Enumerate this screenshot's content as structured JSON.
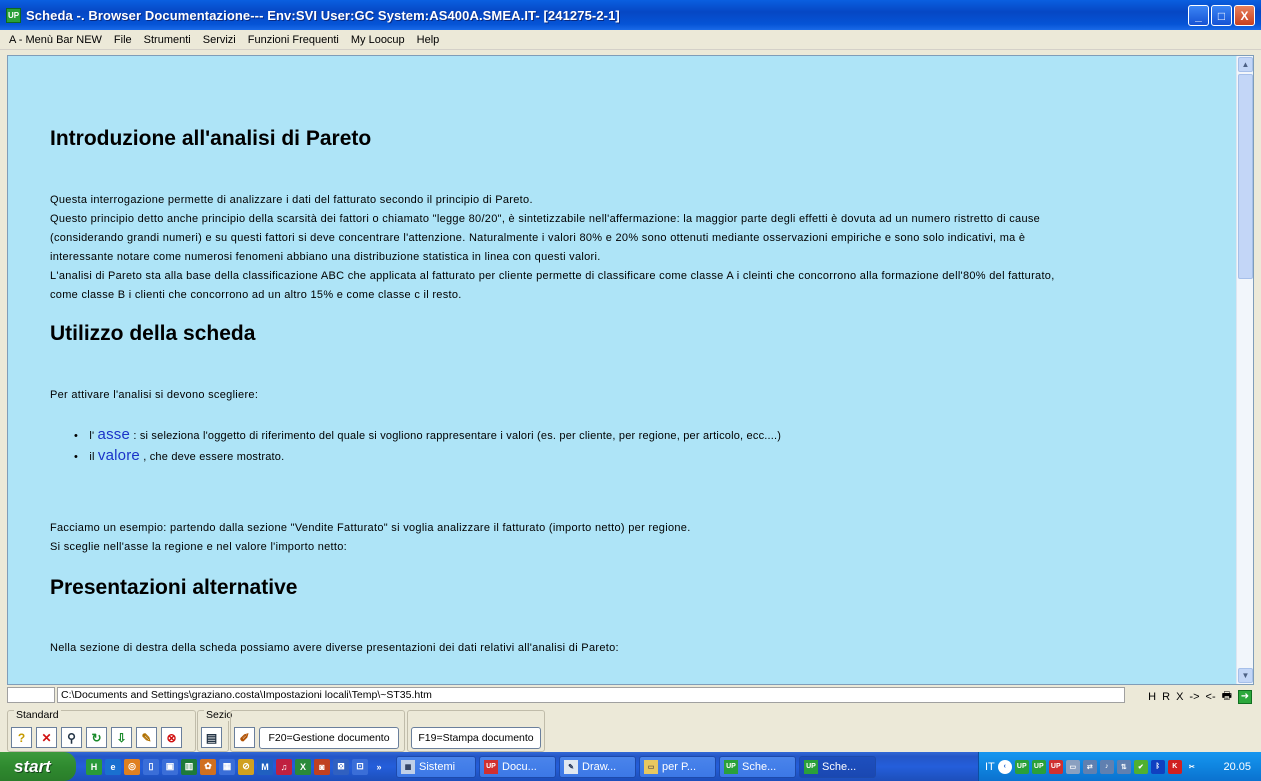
{
  "window": {
    "icon_label": "UP",
    "title": "Scheda -. Browser Documentazione--- Env:SVI User:GC System:AS400A.SMEA.IT- [241275-2-1]",
    "buttons": {
      "minimize": "_",
      "maximize": "□",
      "close": "X"
    }
  },
  "menu": [
    "A - Menù Bar NEW",
    "File",
    "Strumenti",
    "Servizi",
    "Funzioni Frequenti",
    "My Loocup",
    "Help"
  ],
  "doc": {
    "h1": "Introduzione all'analisi di Pareto",
    "p1": [
      "Questa interrogazione permette di analizzare i dati del fatturato secondo il principio di Pareto.",
      "Questo principio detto anche principio della scarsità dei fattori o chiamato \"legge 80/20\", è sintetizzabile nell'affermazione: la maggior parte degli effetti è dovuta ad un numero ristretto di cause",
      "(considerando grandi numeri) e su questi fattori si deve concentrare l'attenzione. Naturalmente i valori 80% e 20% sono ottenuti mediante osservazioni empiriche e sono solo indicativi, ma è",
      "interessante notare come numerosi fenomeni abbiano una distribuzione statistica in linea con questi valori.",
      "L'analisi di Pareto sta alla base della classificazione ABC che applicata al fatturato per cliente permette di classificare come classe A i cleinti che concorrono alla formazione dell'80% del fatturato,",
      "come classe B i clienti che concorrono ad un altro 15% e come classe c il resto."
    ],
    "h2": "Utilizzo della scheda",
    "p2": "Per attivare l'analisi si devono scegliere:",
    "list": [
      {
        "prefix": "l'",
        "term": "asse",
        "text": ": si seleziona l'oggetto di riferimento del quale si vogliono rappresentare i valori (es. per cliente, per regione, per articolo, ecc....)"
      },
      {
        "prefix": "il",
        "term": "valore",
        "text": ", che deve essere mostrato."
      }
    ],
    "p3": [
      "Facciamo un esempio: partendo dalla sezione \"Vendite Fatturato\" si voglia analizzare il fatturato (importo netto) per regione.",
      "Si sceglie nell'asse la regione e nel valore l'importo netto:"
    ],
    "h3": "Presentazioni alternative",
    "p4": "Nella sezione di destra della scheda possiamo avere diverse presentazioni dei dati relativi all'analisi di Pareto:"
  },
  "status": {
    "path": "C:\\Documents and Settings\\graziano.costa\\Impostazioni locali\\Temp\\~ST35.htm",
    "tools": [
      "H",
      "R",
      "X",
      "->",
      "<-"
    ]
  },
  "toolbar": {
    "standard_label": "Standard",
    "sezio_label": "Sezio",
    "standard_icons": [
      "help-icon",
      "close-icon",
      "search-icon",
      "refresh-icon",
      "export-icon",
      "find-icon",
      "stop-icon"
    ],
    "f20": "F20=Gestione documento",
    "f19": "F19=Stampa documento"
  },
  "taskbar": {
    "start": "start",
    "tasks": [
      {
        "label": "Sistemi",
        "icon": "grid"
      },
      {
        "label": "Docu...",
        "icon": "UP"
      },
      {
        "label": "Draw...",
        "icon": "paint"
      },
      {
        "label": "per P...",
        "icon": "folder"
      },
      {
        "label": "Sche...",
        "icon": "UP"
      },
      {
        "label": "Sche...",
        "icon": "UP",
        "active": true
      }
    ],
    "lang": "IT",
    "clock": "20.05"
  }
}
